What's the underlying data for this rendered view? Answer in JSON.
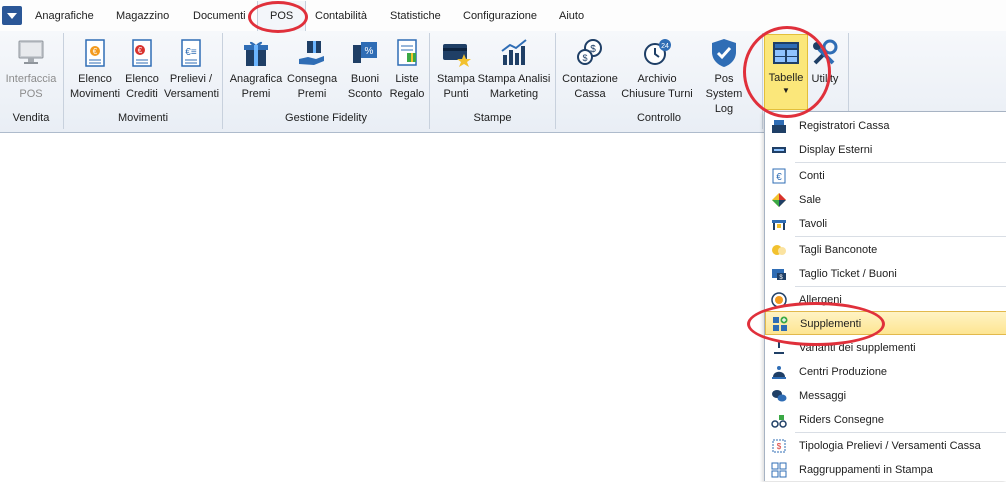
{
  "menubar": {
    "tabs": [
      "Anagrafiche",
      "Magazzino",
      "Documenti",
      "POS",
      "Contabilità",
      "Statistiche",
      "Configurazione",
      "Aiuto"
    ],
    "active_tab": "POS"
  },
  "ribbon": {
    "groups": [
      {
        "label": "Vendita",
        "buttons": [
          {
            "label": "Interfaccia\nPOS",
            "icon": "monitor-cart-icon",
            "disabled": true
          }
        ]
      },
      {
        "label": "Movimenti",
        "buttons": [
          {
            "label": "Elenco\nMovimenti",
            "icon": "euro-list-icon"
          },
          {
            "label": "Elenco\nCrediti",
            "icon": "euro-credit-list-icon"
          },
          {
            "label": "Prelievi /\nVersamenti",
            "icon": "euro-document-icon"
          }
        ]
      },
      {
        "label": "Gestione Fidelity",
        "buttons": [
          {
            "label": "Anagrafica\nPremi",
            "icon": "gift-icon"
          },
          {
            "label": "Consegna\nPremi",
            "icon": "gift-hand-icon"
          },
          {
            "label": "Buoni\nSconto",
            "icon": "discount-coupon-icon"
          },
          {
            "label": "Liste\nRegalo",
            "icon": "gift-list-icon"
          }
        ]
      },
      {
        "label": "Stampe",
        "buttons": [
          {
            "label": "Stampa\nPunti",
            "icon": "card-star-icon"
          },
          {
            "label": "Stampa Analisi\nMarketing",
            "icon": "bar-chart-icon"
          }
        ]
      },
      {
        "label": "Controllo",
        "buttons": [
          {
            "label": "Contazione\nCassa",
            "icon": "coins-icon"
          },
          {
            "label": "Archivio\nChiusure Turni",
            "icon": "clock-24-icon"
          },
          {
            "label": "Pos\nSystem Log",
            "icon": "shield-check-icon"
          }
        ]
      }
    ],
    "tabelle_label": "Tabelle",
    "utility_label": "Utility"
  },
  "dropdown": {
    "items": [
      {
        "label": "Registratori Cassa",
        "icon": "cash-register-icon"
      },
      {
        "label": "Display Esterni",
        "icon": "display-icon"
      },
      {
        "label": "Conti",
        "icon": "euro-account-icon"
      },
      {
        "label": "Sale",
        "icon": "rooms-icon"
      },
      {
        "label": "Tavoli",
        "icon": "table-icon"
      },
      {
        "label": "Tagli Banconote",
        "icon": "banknote-coins-icon"
      },
      {
        "label": "Taglio Ticket / Buoni",
        "icon": "ticket-icon"
      },
      {
        "label": "Allergeni",
        "icon": "allergen-icon"
      },
      {
        "label": "Supplementi",
        "icon": "supplements-icon",
        "highlighted": true
      },
      {
        "label": "Varianti dei supplementi",
        "icon": "variant-icon"
      },
      {
        "label": "Centri Produzione",
        "icon": "production-center-icon"
      },
      {
        "label": "Messaggi",
        "icon": "message-bubbles-icon"
      },
      {
        "label": "Riders Consegne",
        "icon": "rider-icon"
      },
      {
        "label": "Tipologia Prelievi / Versamenti Cassa",
        "icon": "cash-withdraw-type-icon"
      },
      {
        "label": "Raggruppamenti in Stampa",
        "icon": "grouping-grid-icon"
      }
    ]
  },
  "colors": {
    "accent_blue": "#2b5797",
    "highlight_yellow": "#fbe77a",
    "annotation_red": "#e0303b"
  }
}
